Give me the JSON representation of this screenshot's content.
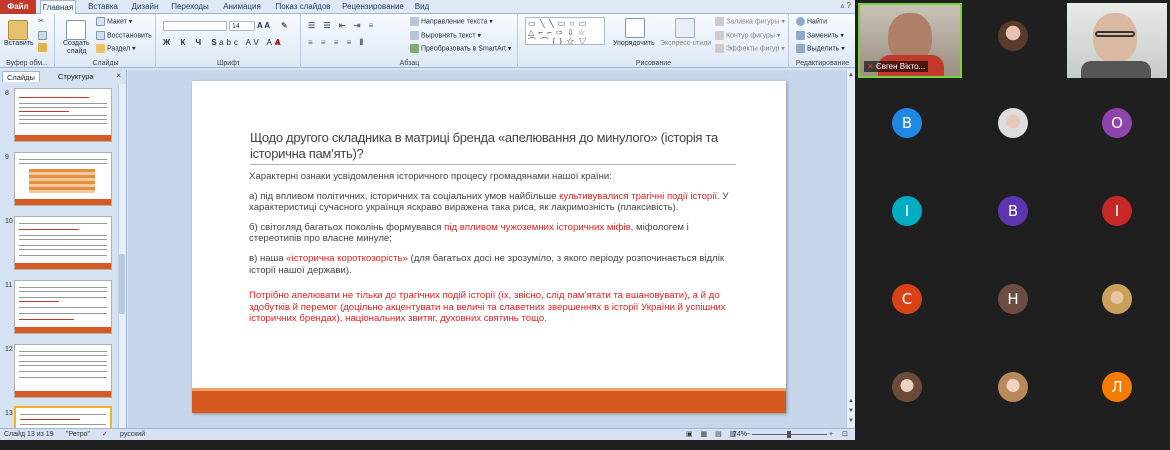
{
  "tabs": {
    "file": "Файл",
    "items": [
      "Главная",
      "Вставка",
      "Дизайн",
      "Переходы",
      "Анимация",
      "Показ слайдов",
      "Рецензирование",
      "Вид"
    ]
  },
  "ribbon": {
    "clipboard": {
      "paste": "Вставить",
      "label": "Буфер обм..."
    },
    "slides": {
      "create": "Создать",
      "create2": "слайд",
      "layout": "Макет",
      "reset": "Восстановить",
      "section": "Раздел",
      "label": "Слайды"
    },
    "font": {
      "size": "14",
      "label": "Шрифт"
    },
    "paragraph": {
      "direction": "Направление текста",
      "align": "Выровнять текст",
      "smartart": "Преобразовать в SmartArt",
      "label": "Абзац"
    },
    "drawing": {
      "arrange": "Упорядочить",
      "quick_styles": "Экспресс-стили",
      "fill": "Заливка фигуры",
      "outline": "Контур фигуры",
      "effects": "Эффекты фигур",
      "label": "Рисование"
    },
    "editing": {
      "find": "Найти",
      "replace": "Заменить",
      "select": "Выделить",
      "label": "Редактирование"
    }
  },
  "slides_pane": {
    "tab_slides": "Слайды",
    "tab_outline": "Структура",
    "close": "×",
    "thumbnails": [
      "8",
      "9",
      "10",
      "11",
      "12",
      "13"
    ]
  },
  "slide": {
    "title": "Щодо другого складника в матриці бренда «апелювання до минулого» (історія та історична пам’ять)?",
    "intro": "Характерні ознаки усвідомлення історичного процесу громадянами нашої країни:",
    "a_prefix": "а) під впливом політичних, історичних та соціальних умов найбільше ",
    "a_red": "культивувалися трагічні події історії",
    "a_rest": ".  У характеристиці сучасного українця яскраво виражена така риса, як лакримозність (плаксивість).",
    "b_prefix": "б) світогляд багатьох поколінь формувався ",
    "b_red": "під впливом чужоземних історичних міфів",
    "b_rest": ", міфологем і стереотипів  про власне минуле;",
    "c_prefix": "в) наша ",
    "c_red": "«історична короткозорість»",
    "c_rest": " (для багатьох досі не зрозуміло, з якого періоду розпочинається відлік історії нашої держави).",
    "conclusion": "Потрібно апелювати не тільки до трагічних подій історії (їх, звісно, слід пам’ятати та вшановувати), а й до здобутків й перемог (доцільно акцентувати на величі та славетних звершеннях в історії України й успішних історичних брендах), національних звитяг, духовних святинь тощо."
  },
  "status": {
    "slide_info": "Слайд 13 из 19",
    "theme": "\"Ретро\"",
    "language": "русский",
    "zoom": "74%"
  },
  "participants": {
    "speaker": "Євген Вікто...",
    "tiles": [
      {
        "letter": "B",
        "color": "#1e88e5"
      },
      {
        "letter": "O",
        "color": "#8e44ad"
      },
      {
        "letter": "I",
        "color": "#00acc1"
      },
      {
        "letter": "B",
        "color": "#5e35b1"
      },
      {
        "letter": "I",
        "color": "#c62828"
      },
      {
        "letter": "C",
        "color": "#d84315"
      },
      {
        "letter": "H",
        "color": "#6d4c41"
      },
      {
        "letter": "Л",
        "color": "#f57c00"
      }
    ]
  },
  "colors": {
    "accent_orange": "#d65a1f",
    "title_red": "#e02020",
    "file_tab": "#c0392b"
  }
}
